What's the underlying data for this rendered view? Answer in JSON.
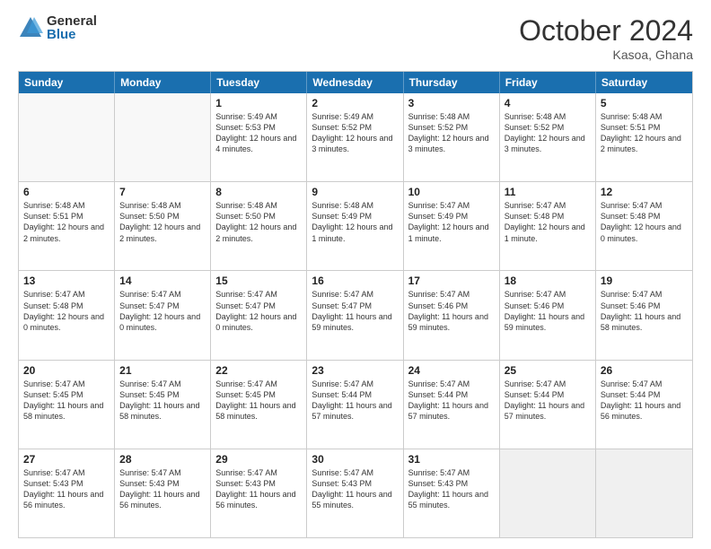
{
  "logo": {
    "general": "General",
    "blue": "Blue"
  },
  "header": {
    "month": "October 2024",
    "location": "Kasoa, Ghana"
  },
  "weekdays": [
    "Sunday",
    "Monday",
    "Tuesday",
    "Wednesday",
    "Thursday",
    "Friday",
    "Saturday"
  ],
  "rows": [
    [
      {
        "day": "",
        "info": "",
        "empty": true
      },
      {
        "day": "",
        "info": "",
        "empty": true
      },
      {
        "day": "1",
        "info": "Sunrise: 5:49 AM\nSunset: 5:53 PM\nDaylight: 12 hours and 4 minutes."
      },
      {
        "day": "2",
        "info": "Sunrise: 5:49 AM\nSunset: 5:52 PM\nDaylight: 12 hours and 3 minutes."
      },
      {
        "day": "3",
        "info": "Sunrise: 5:48 AM\nSunset: 5:52 PM\nDaylight: 12 hours and 3 minutes."
      },
      {
        "day": "4",
        "info": "Sunrise: 5:48 AM\nSunset: 5:52 PM\nDaylight: 12 hours and 3 minutes."
      },
      {
        "day": "5",
        "info": "Sunrise: 5:48 AM\nSunset: 5:51 PM\nDaylight: 12 hours and 2 minutes."
      }
    ],
    [
      {
        "day": "6",
        "info": "Sunrise: 5:48 AM\nSunset: 5:51 PM\nDaylight: 12 hours and 2 minutes."
      },
      {
        "day": "7",
        "info": "Sunrise: 5:48 AM\nSunset: 5:50 PM\nDaylight: 12 hours and 2 minutes."
      },
      {
        "day": "8",
        "info": "Sunrise: 5:48 AM\nSunset: 5:50 PM\nDaylight: 12 hours and 2 minutes."
      },
      {
        "day": "9",
        "info": "Sunrise: 5:48 AM\nSunset: 5:49 PM\nDaylight: 12 hours and 1 minute."
      },
      {
        "day": "10",
        "info": "Sunrise: 5:47 AM\nSunset: 5:49 PM\nDaylight: 12 hours and 1 minute."
      },
      {
        "day": "11",
        "info": "Sunrise: 5:47 AM\nSunset: 5:48 PM\nDaylight: 12 hours and 1 minute."
      },
      {
        "day": "12",
        "info": "Sunrise: 5:47 AM\nSunset: 5:48 PM\nDaylight: 12 hours and 0 minutes."
      }
    ],
    [
      {
        "day": "13",
        "info": "Sunrise: 5:47 AM\nSunset: 5:48 PM\nDaylight: 12 hours and 0 minutes."
      },
      {
        "day": "14",
        "info": "Sunrise: 5:47 AM\nSunset: 5:47 PM\nDaylight: 12 hours and 0 minutes."
      },
      {
        "day": "15",
        "info": "Sunrise: 5:47 AM\nSunset: 5:47 PM\nDaylight: 12 hours and 0 minutes."
      },
      {
        "day": "16",
        "info": "Sunrise: 5:47 AM\nSunset: 5:47 PM\nDaylight: 11 hours and 59 minutes."
      },
      {
        "day": "17",
        "info": "Sunrise: 5:47 AM\nSunset: 5:46 PM\nDaylight: 11 hours and 59 minutes."
      },
      {
        "day": "18",
        "info": "Sunrise: 5:47 AM\nSunset: 5:46 PM\nDaylight: 11 hours and 59 minutes."
      },
      {
        "day": "19",
        "info": "Sunrise: 5:47 AM\nSunset: 5:46 PM\nDaylight: 11 hours and 58 minutes."
      }
    ],
    [
      {
        "day": "20",
        "info": "Sunrise: 5:47 AM\nSunset: 5:45 PM\nDaylight: 11 hours and 58 minutes."
      },
      {
        "day": "21",
        "info": "Sunrise: 5:47 AM\nSunset: 5:45 PM\nDaylight: 11 hours and 58 minutes."
      },
      {
        "day": "22",
        "info": "Sunrise: 5:47 AM\nSunset: 5:45 PM\nDaylight: 11 hours and 58 minutes."
      },
      {
        "day": "23",
        "info": "Sunrise: 5:47 AM\nSunset: 5:44 PM\nDaylight: 11 hours and 57 minutes."
      },
      {
        "day": "24",
        "info": "Sunrise: 5:47 AM\nSunset: 5:44 PM\nDaylight: 11 hours and 57 minutes."
      },
      {
        "day": "25",
        "info": "Sunrise: 5:47 AM\nSunset: 5:44 PM\nDaylight: 11 hours and 57 minutes."
      },
      {
        "day": "26",
        "info": "Sunrise: 5:47 AM\nSunset: 5:44 PM\nDaylight: 11 hours and 56 minutes."
      }
    ],
    [
      {
        "day": "27",
        "info": "Sunrise: 5:47 AM\nSunset: 5:43 PM\nDaylight: 11 hours and 56 minutes."
      },
      {
        "day": "28",
        "info": "Sunrise: 5:47 AM\nSunset: 5:43 PM\nDaylight: 11 hours and 56 minutes."
      },
      {
        "day": "29",
        "info": "Sunrise: 5:47 AM\nSunset: 5:43 PM\nDaylight: 11 hours and 56 minutes."
      },
      {
        "day": "30",
        "info": "Sunrise: 5:47 AM\nSunset: 5:43 PM\nDaylight: 11 hours and 55 minutes."
      },
      {
        "day": "31",
        "info": "Sunrise: 5:47 AM\nSunset: 5:43 PM\nDaylight: 11 hours and 55 minutes."
      },
      {
        "day": "",
        "info": "",
        "empty": true,
        "shaded": true
      },
      {
        "day": "",
        "info": "",
        "empty": true,
        "shaded": true
      }
    ]
  ]
}
